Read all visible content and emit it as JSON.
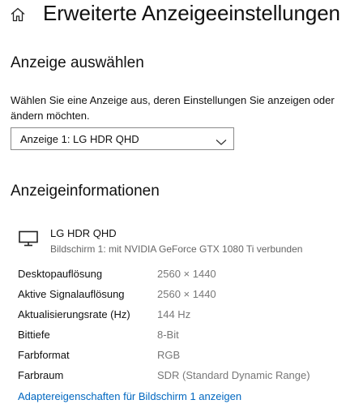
{
  "header": {
    "title": "Erweiterte Anzeigeeinstellungen",
    "home_icon": "home-icon"
  },
  "select_display": {
    "title": "Anzeige auswählen",
    "description": "Wählen Sie eine Anzeige aus, deren Einstellungen Sie anzeigen oder ändern möchten.",
    "dropdown_value": "Anzeige 1: LG HDR QHD",
    "dropdown_icon": "chevron-down-icon"
  },
  "display_info": {
    "title": "Anzeigeinformationen",
    "monitor_icon": "monitor-icon",
    "display_name": "LG HDR QHD",
    "display_subtitle": "Bildschirm 1: mit NVIDIA GeForce GTX 1080 Ti verbunden",
    "rows": [
      {
        "label": "Desktopauflösung",
        "value": "2560 × 1440"
      },
      {
        "label": "Aktive Signalauflösung",
        "value": "2560 × 1440"
      },
      {
        "label": "Aktualisierungsrate (Hz)",
        "value": "144 Hz"
      },
      {
        "label": "Bittiefe",
        "value": "8-Bit"
      },
      {
        "label": "Farbformat",
        "value": "RGB"
      },
      {
        "label": "Farbraum",
        "value": "SDR (Standard Dynamic Range)"
      }
    ],
    "adapter_link": "Adaptereigenschaften für Bildschirm 1 anzeigen"
  },
  "colors": {
    "link": "#0067c0",
    "value_text": "#777777",
    "subtitle_text": "#666666",
    "dropdown_border": "#8a8a8a"
  }
}
